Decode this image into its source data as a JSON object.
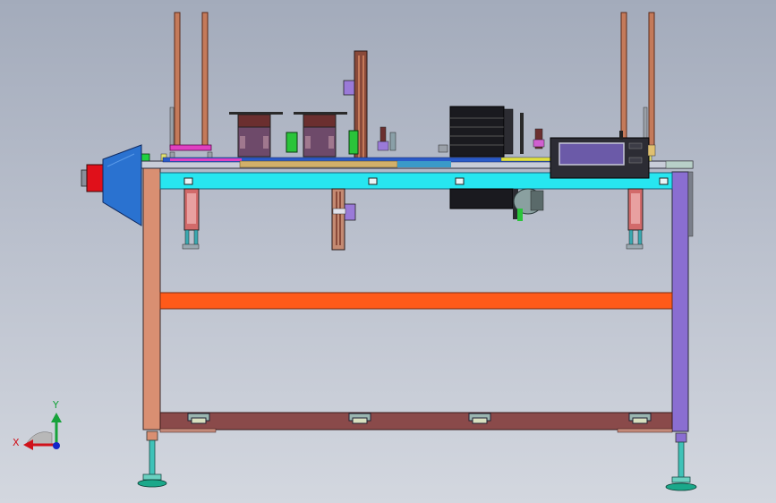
{
  "viewport": {
    "background_top": "#a3abbb",
    "background_bottom": "#d3d7df"
  },
  "triad": {
    "x_label": "X",
    "y_label": "Y",
    "x_color": "#d0121b",
    "y_color": "#16a23a",
    "z_color": "#1326c8"
  },
  "colors": {
    "frame_left_post": "#d98f72",
    "frame_right_post": "#8a6ed1",
    "top_beam": "#27e6f0",
    "middle_rail": "#ff5a1a",
    "bottom_rail": "#8a4a4a",
    "motor_cone": "#2a72d0",
    "motor_end": "#e0101a",
    "control_box": "#2c2c34",
    "control_screen": "#6b5aa8",
    "heater_block": "#6b2f2f",
    "heater_body": "#6e4a6a",
    "guide_rod": "#c47a5a",
    "leveling_foot": "#1aa88a"
  }
}
